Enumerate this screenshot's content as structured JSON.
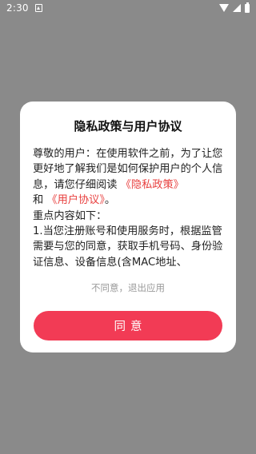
{
  "status_bar": {
    "time": "2:30",
    "icons": [
      "notification-icon",
      "wifi-icon",
      "signal-icon",
      "battery-icon"
    ]
  },
  "dialog": {
    "title": "隐私政策与用户协议",
    "body": {
      "intro": "尊敬的用户：在使用软件之前，为了让您更好地了解我们是如何保护用户的个人信息，请您仔细阅读",
      "privacy_link": "《隐私政策》",
      "and": "和",
      "agreement_link": "《用户协议》",
      "period": "。",
      "key_points": "重点内容如下：",
      "point_1": "1.当您注册账号和使用服务时，根据监管需要与您的同意，获取手机号码、身份验证信息、设备信息(含MAC地址、"
    },
    "disagree_label": "不同意，退出应用",
    "agree_label": "同意"
  },
  "colors": {
    "accent": "#f23b55",
    "link": "#e8403f",
    "overlay": "#8a8a8a"
  }
}
